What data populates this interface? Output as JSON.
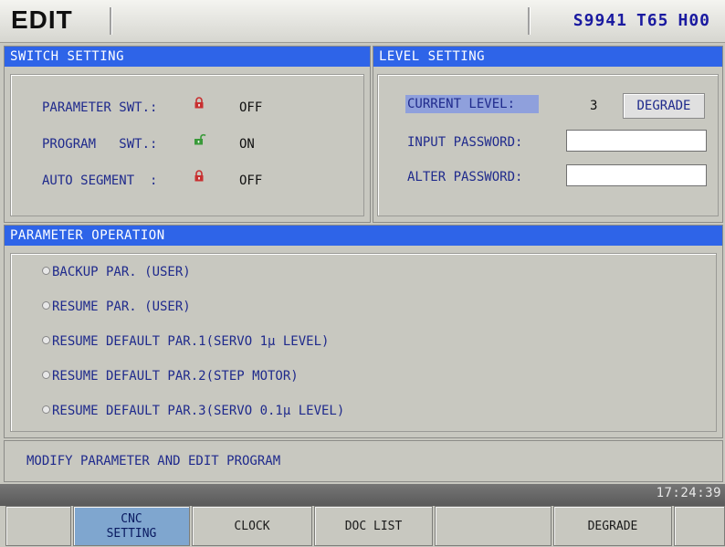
{
  "header": {
    "mode": "EDIT",
    "status": {
      "s": "S9941",
      "t": "T65",
      "h": "H00"
    }
  },
  "switch_setting": {
    "title": "SWITCH SETTING",
    "rows": [
      {
        "label": "PARAMETER SWT.:",
        "state": "OFF",
        "locked": true
      },
      {
        "label": "PROGRAM   SWT.:",
        "state": "ON",
        "locked": false
      },
      {
        "label": "AUTO SEGMENT  :",
        "state": "OFF",
        "locked": true
      }
    ]
  },
  "level_setting": {
    "title": "LEVEL SETTING",
    "current_level_label": "CURRENT LEVEL:",
    "current_level_value": "3",
    "degrade_button": "DEGRADE",
    "input_password_label": "INPUT PASSWORD:",
    "input_password_value": "",
    "alter_password_label": "ALTER PASSWORD:",
    "alter_password_value": ""
  },
  "parameter_operation": {
    "title": "PARAMETER OPERATION",
    "options": [
      "BACKUP PAR. (USER)",
      "RESUME PAR. (USER)",
      "RESUME DEFAULT PAR.1(SERVO 1µ LEVEL)",
      "RESUME DEFAULT PAR.2(STEP MOTOR)",
      "RESUME DEFAULT PAR.3(SERVO 0.1µ LEVEL)"
    ]
  },
  "message": "MODIFY PARAMETER AND EDIT PROGRAM",
  "clock": "17:24:39",
  "softkeys": {
    "cnc_setting": "CNC SETTING",
    "cnc_setting_line1": "CNC",
    "cnc_setting_line2": "SETTING",
    "clock": "CLOCK",
    "doc_list": "DOC LIST",
    "degrade": "DEGRADE"
  },
  "colors": {
    "panel_header": "#2e64e8",
    "label_text": "#1f2a8c",
    "active_softkey": "#7fa6cf",
    "highlight": "#8fa0dc",
    "lock_red": "#c83030",
    "lock_green": "#3a9a3a"
  }
}
